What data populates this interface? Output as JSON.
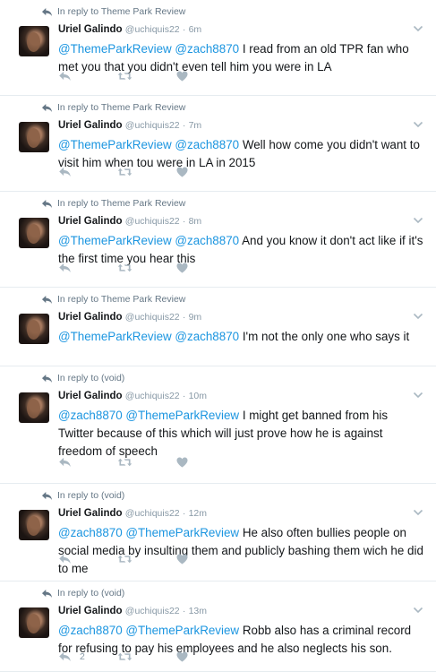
{
  "colors": {
    "link": "#1b95e0",
    "muted": "#8899a6",
    "icon": "#aab8c2",
    "divider": "#e6ecf0"
  },
  "icons": {
    "context": "reply-arrow-icon",
    "reply": "reply-icon",
    "retweet": "retweet-icon",
    "like": "heart-icon",
    "menu": "chevron-down-icon"
  },
  "tweets": [
    {
      "context": "In reply to Theme Park Review",
      "name": "Uriel Galindo",
      "handle": "@uchiquis22",
      "sep": "·",
      "time": "6m",
      "mentions": "@ThemeParkReview @zach8870",
      "body": " I read from an old TPR fan who met you that you didn't even tell him you were in LA",
      "reply_count": ""
    },
    {
      "context": "In reply to Theme Park Review",
      "name": "Uriel Galindo",
      "handle": "@uchiquis22",
      "sep": "·",
      "time": "7m",
      "mentions": "@ThemeParkReview @zach8870",
      "body": " Well how come you didn't want to visit him when tou were in LA in 2015",
      "reply_count": ""
    },
    {
      "context": "In reply to Theme Park Review",
      "name": "Uriel Galindo",
      "handle": "@uchiquis22",
      "sep": "·",
      "time": "8m",
      "mentions": "@ThemeParkReview @zach8870",
      "body": " And you know it don't act like if it's the first time you hear this",
      "reply_count": ""
    },
    {
      "context": "In reply to Theme Park Review",
      "name": "Uriel Galindo",
      "handle": "@uchiquis22",
      "sep": "·",
      "time": "9m",
      "mentions": "@ThemeParkReview @zach8870",
      "body": " I'm not the only one who says it",
      "reply_count": ""
    },
    {
      "context": "In reply to (void)",
      "name": "Uriel Galindo",
      "handle": "@uchiquis22",
      "sep": "·",
      "time": "10m",
      "mentions": "@zach8870 @ThemeParkReview",
      "body": " I might get banned from his Twitter because of this which will just prove how he is against freedom of speech",
      "reply_count": ""
    },
    {
      "context": "In reply to (void)",
      "name": "Uriel Galindo",
      "handle": "@uchiquis22",
      "sep": "·",
      "time": "12m",
      "mentions": "@zach8870 @ThemeParkReview",
      "body": " He also often bullies people on social media by insulting them and publicly bashing them wich he did to me",
      "reply_count": ""
    },
    {
      "context": "In reply to (void)",
      "name": "Uriel Galindo",
      "handle": "@uchiquis22",
      "sep": "·",
      "time": "13m",
      "mentions": "@zach8870 @ThemeParkReview",
      "body": " Robb also has a criminal record for refusing to pay his employees and he also neglects his son.",
      "reply_count": "2"
    }
  ]
}
